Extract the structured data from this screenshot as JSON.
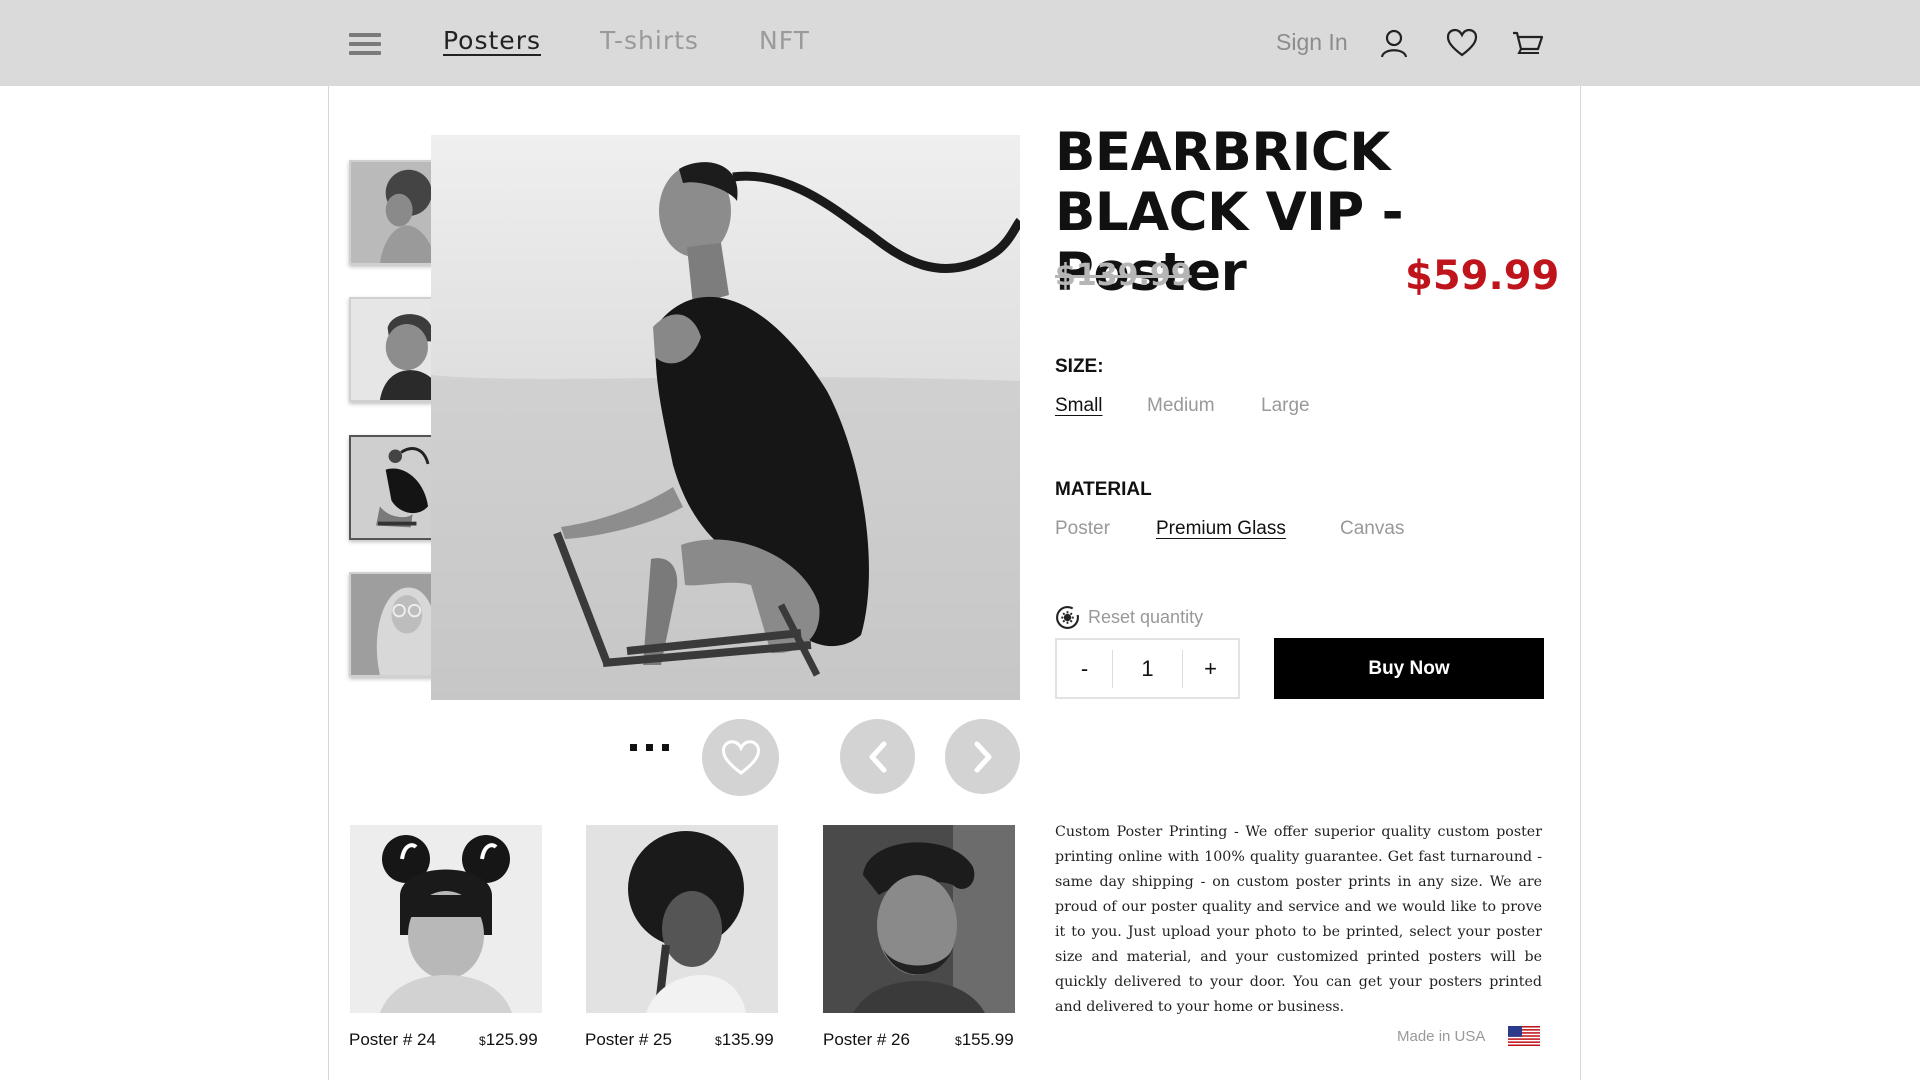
{
  "nav": {
    "items": [
      {
        "label": "Posters",
        "active": true
      },
      {
        "label": "T-shirts",
        "active": false
      },
      {
        "label": "NFT",
        "active": false
      }
    ],
    "sign_in": "Sign In",
    "icons": [
      "menu-icon",
      "user-icon",
      "heart-icon",
      "cart-icon"
    ]
  },
  "product": {
    "title_line1": "BEARBRICK",
    "title_line2": "BLACK VIP - Poster",
    "old_price": "$139.99",
    "price": "$59.99",
    "size_label": "SIZE:",
    "sizes": [
      "Small",
      "Medium",
      "Large"
    ],
    "selected_size": "Small",
    "material_label": "MATERIAL",
    "materials": [
      "Poster",
      "Premium Glass",
      "Canvas"
    ],
    "selected_material": "Premium Glass",
    "reset_label": "Reset quantity",
    "qty_minus": "-",
    "qty_plus": "+",
    "quantity": "1",
    "buy_label": "Buy Now",
    "description": "Custom Poster Printing - We offer superior quality custom poster printing online with 100% quality guarantee. Get fast turnaround - same day shipping - on custom poster prints in any size. We are proud of our poster quality and service and we would like to prove it to you. Just upload your photo to be printed, select your poster size and material, and your customized printed posters will be quickly delivered to your door. You can get your posters printed and delivered to your home or business.",
    "made_in": "Made in USA"
  },
  "gallery": {
    "selected_thumb": 3,
    "thumbs": [
      "thumb-1",
      "thumb-2",
      "thumb-3",
      "thumb-4"
    ]
  },
  "related": [
    {
      "name": "Poster # 24",
      "currency": "$",
      "price": "125.99"
    },
    {
      "name": "Poster # 25",
      "currency": "$",
      "price": "135.99"
    },
    {
      "name": "Poster # 26",
      "currency": "$",
      "price": "155.99"
    }
  ],
  "colors": {
    "topbar": "#dadada",
    "accent_price": "#c0141d",
    "buy_button": "#000000"
  }
}
